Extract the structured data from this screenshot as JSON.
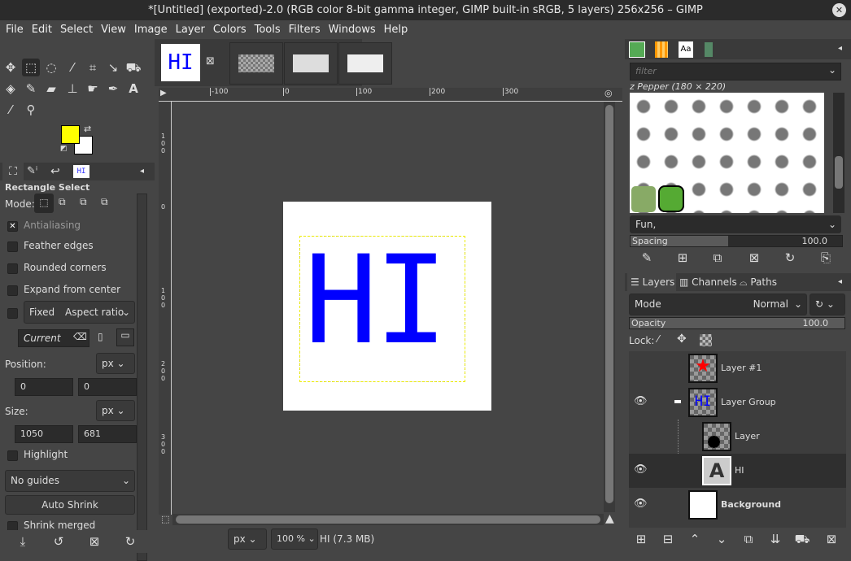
{
  "window": {
    "title": "*[Untitled] (exported)-2.0 (RGB color 8-bit gamma integer, GIMP built-in sRGB, 5 layers) 256x256 – GIMP",
    "close": "✕"
  },
  "menu": [
    "File",
    "Edit",
    "Select",
    "View",
    "Image",
    "Layer",
    "Colors",
    "Tools",
    "Filters",
    "Windows",
    "Help"
  ],
  "toolbox": {
    "fg_color": "#ffff00",
    "bg_color": "#ffffff"
  },
  "tool_options": {
    "title": "Rectangle Select",
    "mode_label": "Mode:",
    "antialiasing": "Antialiasing",
    "feather": "Feather edges",
    "rounded": "Rounded corners",
    "expand": "Expand from center",
    "fixed": "Fixed",
    "fixed_select": "Aspect ratio",
    "current": "Current",
    "position_label": "Position:",
    "position_unit": "px",
    "pos_x": "0",
    "pos_y": "0",
    "size_label": "Size:",
    "size_unit": "px",
    "width": "1050",
    "height": "681",
    "highlight": "Highlight",
    "guides": "No guides",
    "auto_shrink": "Auto Shrink",
    "shrink_merged": "Shrink merged",
    "tab_image_label": "HI"
  },
  "image_tabs": {
    "active_label": "HI"
  },
  "ruler": {
    "h": [
      "-100",
      "0",
      "100",
      "200",
      "300"
    ],
    "v": [
      "1\n0\n0",
      "0",
      "1\n0\n0",
      "2\n0\n0",
      "3\n0\n0"
    ]
  },
  "canvas": {
    "text": "HI",
    "text_color": "#0000ff"
  },
  "status": {
    "unit": "px",
    "zoom": "100 %",
    "info": "HI (7.3 MB)"
  },
  "brushes": {
    "filter_placeholder": "filter",
    "brush_name": "z Pepper (180 × 220)",
    "tag": "Fun,",
    "spacing_label": "Spacing",
    "spacing": "100.0",
    "tab_font": "Aa"
  },
  "layers_panel": {
    "tabs": [
      "Layers",
      "Channels",
      "Paths"
    ],
    "mode_label": "Mode",
    "mode": "Normal",
    "opacity_label": "Opacity",
    "opacity": "100.0",
    "lock_label": "Lock:",
    "layers": [
      {
        "name": "Layer #1",
        "visible": false
      },
      {
        "name": "Layer Group",
        "visible": true
      },
      {
        "name": "Layer",
        "visible": false
      },
      {
        "name": "HI",
        "visible": true
      },
      {
        "name": "Background",
        "visible": true
      }
    ]
  }
}
